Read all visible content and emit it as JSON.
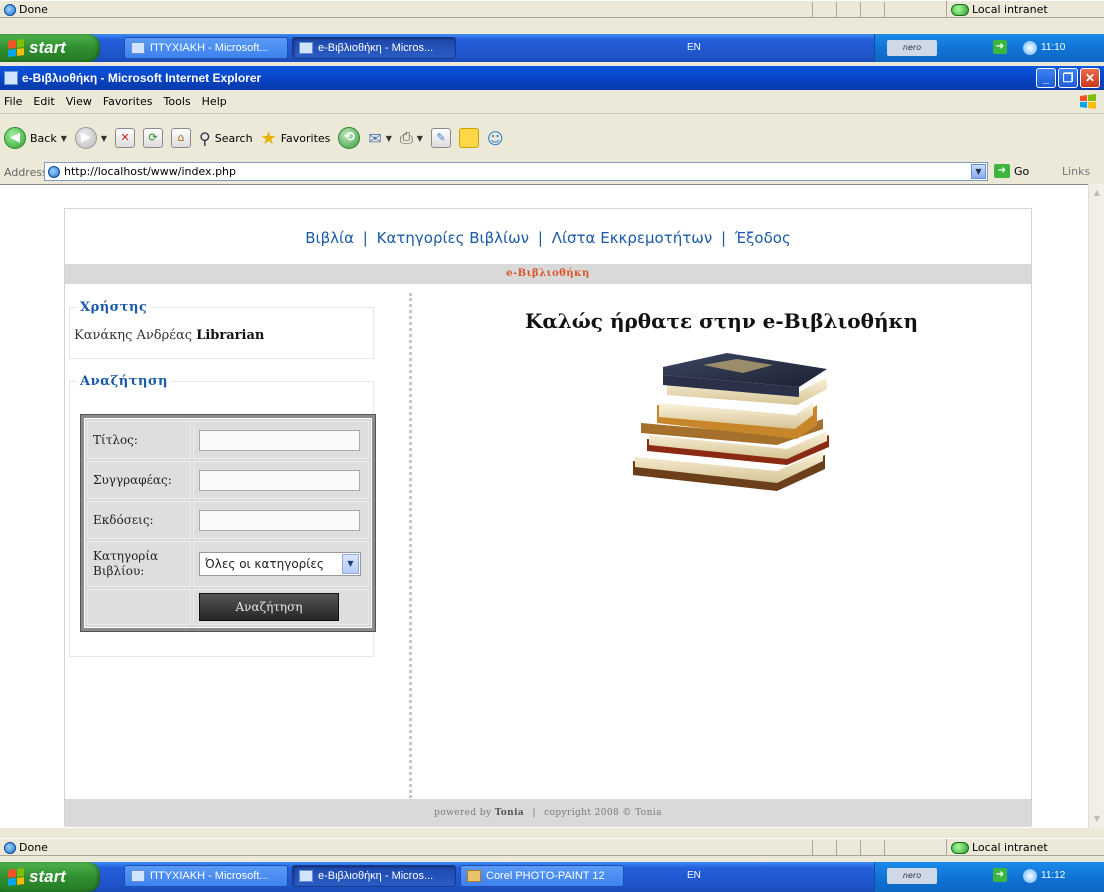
{
  "status_top": {
    "left": "Done",
    "zone": "Local intranet"
  },
  "taskbar_top": {
    "start_label": "start",
    "tasks": [
      "ΠΤΥΧΙΑΚΗ - Microsoft...",
      "e-Βιβλιοθήκη - Micros..."
    ],
    "lang": "EN",
    "nero": "nero",
    "time": "11:10"
  },
  "window": {
    "title": "e-Βιβλιοθήκη - Microsoft Internet Explorer"
  },
  "menu": [
    "File",
    "Edit",
    "View",
    "Favorites",
    "Tools",
    "Help"
  ],
  "toolbar": {
    "back": "Back",
    "search": "Search",
    "favorites": "Favorites"
  },
  "address": {
    "label": "Address",
    "url": "http://localhost/www/index.php",
    "go": "Go",
    "links": "Links"
  },
  "site": {
    "nav": [
      "Βιβλία",
      "Κατηγορίες Βιβλίων",
      "Λίστα Εκκρεμοτήτων",
      "Έξοδος"
    ],
    "nav_sep": "|",
    "breadcrumb": "e-Βιβλιοθήκη",
    "user_box": {
      "title": "Χρήστης",
      "surname": "Κανάκης",
      "name": "Ανδρέας",
      "role": "Librarian"
    },
    "search_box": {
      "title": "Αναζήτηση",
      "fields": [
        "Τίτλος:",
        "Συγγραφέας:",
        "Εκδόσεις:",
        "Κατηγορία Βιβλίου:"
      ],
      "category_selected": "Όλες οι κατηγορίες",
      "button": "Αναζήτηση"
    },
    "welcome": "Καλώς ήρθατε στην e-Βιβλιοθήκη",
    "footer": {
      "powered": "powered by",
      "author": "Tonia",
      "sep": "|",
      "copyright": "copyright 2008 © Tonia"
    }
  },
  "status_bottom": {
    "left": "Done",
    "zone": "Local intranet"
  },
  "taskbar_bottom": {
    "start_label": "start",
    "tasks": [
      "ΠΤΥΧΙΑΚΗ - Microsoft...",
      "e-Βιβλιοθήκη - Micros...",
      "Corel PHOTO-PAINT 12"
    ],
    "lang": "EN",
    "nero": "nero",
    "time": "11:12"
  },
  "colors": {
    "link_blue": "#1a5aa8",
    "breadcrumb_orange": "#d9572b",
    "xp_blue": "#245edb",
    "start_green": "#2f8f2f"
  }
}
